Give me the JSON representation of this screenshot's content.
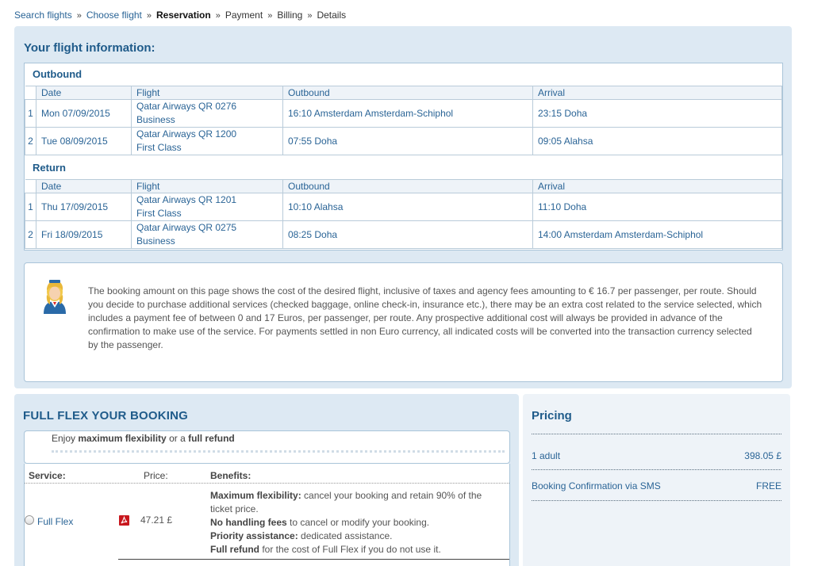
{
  "breadcrumb": {
    "steps": [
      "Search flights",
      "Choose flight",
      "Reservation",
      "Payment",
      "Billing",
      "Details"
    ],
    "separator": "»"
  },
  "flight_info": {
    "title": "Your flight information:",
    "columns": {
      "date": "Date",
      "flight": "Flight",
      "outbound": "Outbound",
      "arrival": "Arrival"
    },
    "outbound": {
      "title": "Outbound",
      "rows": [
        {
          "idx": "1",
          "date": "Mon 07/09/2015",
          "flight": "Qatar Airways QR 0276",
          "class": "Business",
          "outbound": "16:10 Amsterdam Amsterdam-Schiphol",
          "arrival": "23:15 Doha"
        },
        {
          "idx": "2",
          "date": "Tue 08/09/2015",
          "flight": "Qatar Airways QR 1200",
          "class": "First Class",
          "outbound": "07:55 Doha",
          "arrival": "09:05 Alahsa"
        }
      ]
    },
    "return": {
      "title": "Return",
      "rows": [
        {
          "idx": "1",
          "date": "Thu 17/09/2015",
          "flight": "Qatar Airways QR 1201",
          "class": "First Class",
          "outbound": "10:10 Alahsa",
          "arrival": "11:10 Doha"
        },
        {
          "idx": "2",
          "date": "Fri 18/09/2015",
          "flight": "Qatar Airways QR 0275",
          "class": "Business",
          "outbound": "08:25 Doha",
          "arrival": "14:00 Amsterdam Amsterdam-Schiphol"
        }
      ]
    },
    "notice": "The booking amount on this page shows the cost of the desired flight, inclusive of taxes and agency fees amounting to € 16.7 per passenger, per route. Should you decide to purchase additional services (checked baggage, online check-in, insurance etc.), there may be an extra cost related to the service selected, which includes a payment fee of between 0 and 17 Euros, per passenger, per route. Any prospective additional cost will always be provided in advance of the confirmation to make use of the service. For payments settled in non Euro currency, all indicated costs will be converted into the transaction currency selected by the passenger."
  },
  "full_flex": {
    "title": "FULL FLEX YOUR BOOKING",
    "enjoy_prefix": "Enjoy ",
    "enjoy_bold1": "maximum flexibility",
    "enjoy_mid": " or a ",
    "enjoy_bold2": "full refund",
    "headers": {
      "service": "Service:",
      "price": "Price:",
      "benefits": "Benefits:"
    },
    "option": {
      "name": "Full Flex",
      "price": "47.21 £",
      "benefits": [
        {
          "bold": "Maximum flexibility:",
          "text": " cancel your booking and retain 90% of the ticket price."
        },
        {
          "bold": "No handling fees",
          "text": " to cancel or modify your booking."
        },
        {
          "bold": "Priority assistance:",
          "text": " dedicated assistance."
        },
        {
          "bold": "Full refund",
          "text": " for the cost of Full Flex if you do not use it."
        }
      ]
    }
  },
  "pricing": {
    "title": "Pricing",
    "rows": [
      {
        "label": "1 adult",
        "value": "398.05 £"
      },
      {
        "label": "Booking Confirmation via SMS",
        "value": "FREE"
      }
    ]
  },
  "colors": {
    "accent": "#1f5b8a",
    "panel": "#dde9f3",
    "link": "#2a6496",
    "pdf": "#c8171e"
  }
}
